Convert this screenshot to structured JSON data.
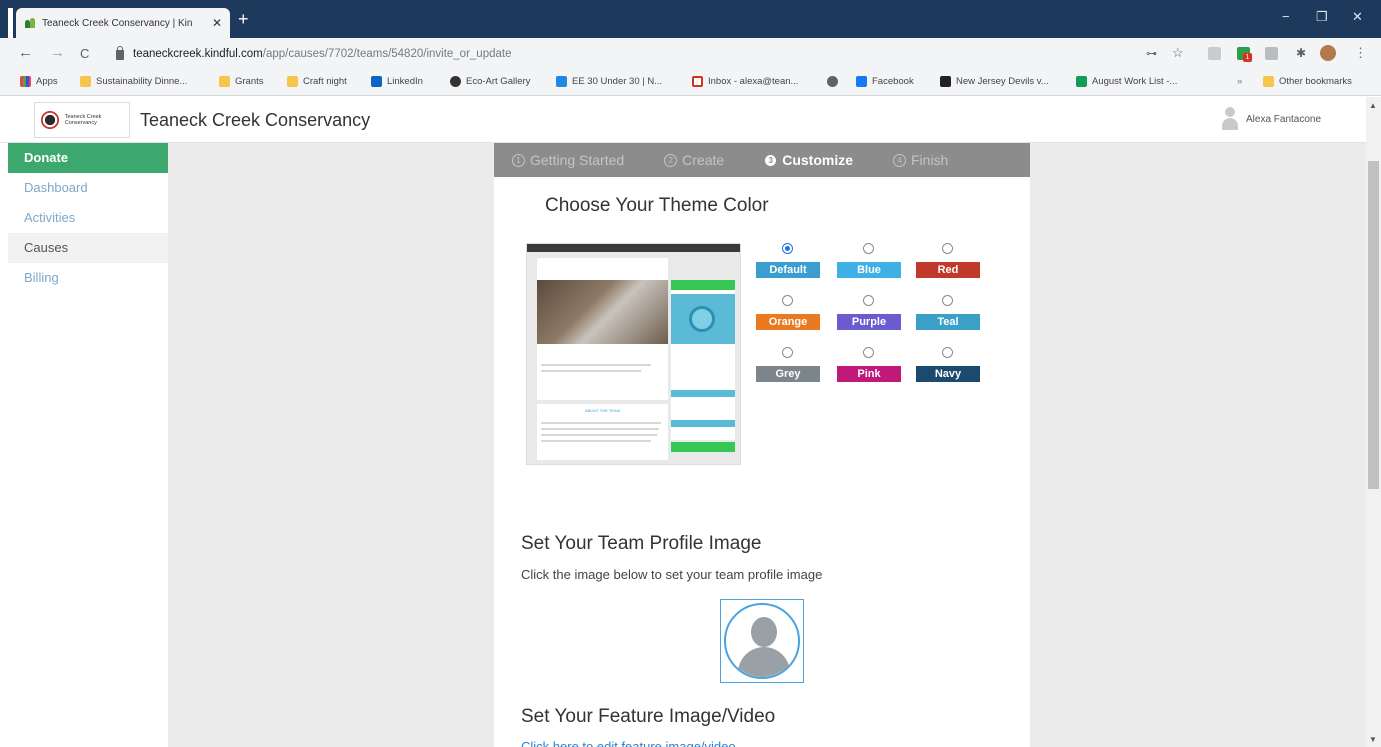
{
  "browser": {
    "tab_title": "Teaneck Creek Conservancy | Kin",
    "tab_close": "✕",
    "new_tab": "+",
    "window_controls": {
      "minimize": "−",
      "maximize": "❐",
      "close": "✕"
    },
    "nav": {
      "back": "←",
      "forward": "→",
      "reload": "C"
    },
    "url_host": "teaneckcreek.kindful.com",
    "url_path": "/app/causes/7702/teams/54820/invite_or_update",
    "omnibox_icons": {
      "key": "⊶",
      "star": "☆",
      "puzzle": "✱",
      "menu": "⋮"
    },
    "extension_badge": "1"
  },
  "bookmarks": [
    {
      "label": "Apps",
      "icon": "apps-grid-icon"
    },
    {
      "label": "Sustainability Dinne...",
      "icon": "folder-icon"
    },
    {
      "label": "Grants",
      "icon": "folder-icon"
    },
    {
      "label": "Craft night",
      "icon": "folder-icon"
    },
    {
      "label": "LinkedIn",
      "icon": "linkedin-icon"
    },
    {
      "label": "Eco-Art Gallery",
      "icon": "gallery-icon"
    },
    {
      "label": "EE 30 Under 30 | N...",
      "icon": "bookmark-icon"
    },
    {
      "label": "Inbox - alexa@tean...",
      "icon": "gmail-icon"
    },
    {
      "label": "",
      "icon": "globe-icon"
    },
    {
      "label": "Facebook",
      "icon": "facebook-icon"
    },
    {
      "label": "New Jersey Devils v...",
      "icon": "page-icon"
    },
    {
      "label": "August Work List -...",
      "icon": "sheets-icon"
    }
  ],
  "bookmarks_more": "»",
  "other_bookmarks": "Other bookmarks",
  "app": {
    "logo_text": "Teaneck Creek Conservancy",
    "org_name": "Teaneck Creek Conservancy",
    "user_name": "Alexa Fantacone"
  },
  "sidebar": {
    "items": [
      {
        "label": "Donate",
        "state": "active"
      },
      {
        "label": "Dashboard",
        "state": "normal"
      },
      {
        "label": "Activities",
        "state": "normal"
      },
      {
        "label": "Causes",
        "state": "current"
      },
      {
        "label": "Billing",
        "state": "normal"
      }
    ]
  },
  "steps": [
    {
      "num": "1",
      "label": "Getting Started",
      "current": false
    },
    {
      "num": "2",
      "label": "Create",
      "current": false
    },
    {
      "num": "3",
      "label": "Customize",
      "current": true
    },
    {
      "num": "4",
      "label": "Finish",
      "current": false
    }
  ],
  "theme": {
    "heading": "Choose Your Theme Color",
    "preview_about": "ABOUT THE TEAM",
    "options": [
      {
        "label": "Default",
        "color": "#3a9fd0",
        "checked": true
      },
      {
        "label": "Blue",
        "color": "#3fb0e6",
        "checked": false
      },
      {
        "label": "Red",
        "color": "#c0392b",
        "checked": false
      },
      {
        "label": "Orange",
        "color": "#ea7a21",
        "checked": false
      },
      {
        "label": "Purple",
        "color": "#6a5ccf",
        "checked": false
      },
      {
        "label": "Teal",
        "color": "#3aa0c8",
        "checked": false
      },
      {
        "label": "Grey",
        "color": "#7b858a",
        "checked": false
      },
      {
        "label": "Pink",
        "color": "#c2187a",
        "checked": false
      },
      {
        "label": "Navy",
        "color": "#1a4a6e",
        "checked": false
      }
    ]
  },
  "profile": {
    "heading": "Set Your Team Profile Image",
    "instruction": "Click the image below to set your team profile image"
  },
  "feature": {
    "heading": "Set Your Feature Image/Video",
    "link": "Click here to edit feature image/video"
  },
  "colors": {
    "titlebar": "#1d3a5c",
    "sidebar_active": "#3da86d",
    "steps_bar": "#8c8c8c",
    "link": "#2a7fd4"
  }
}
